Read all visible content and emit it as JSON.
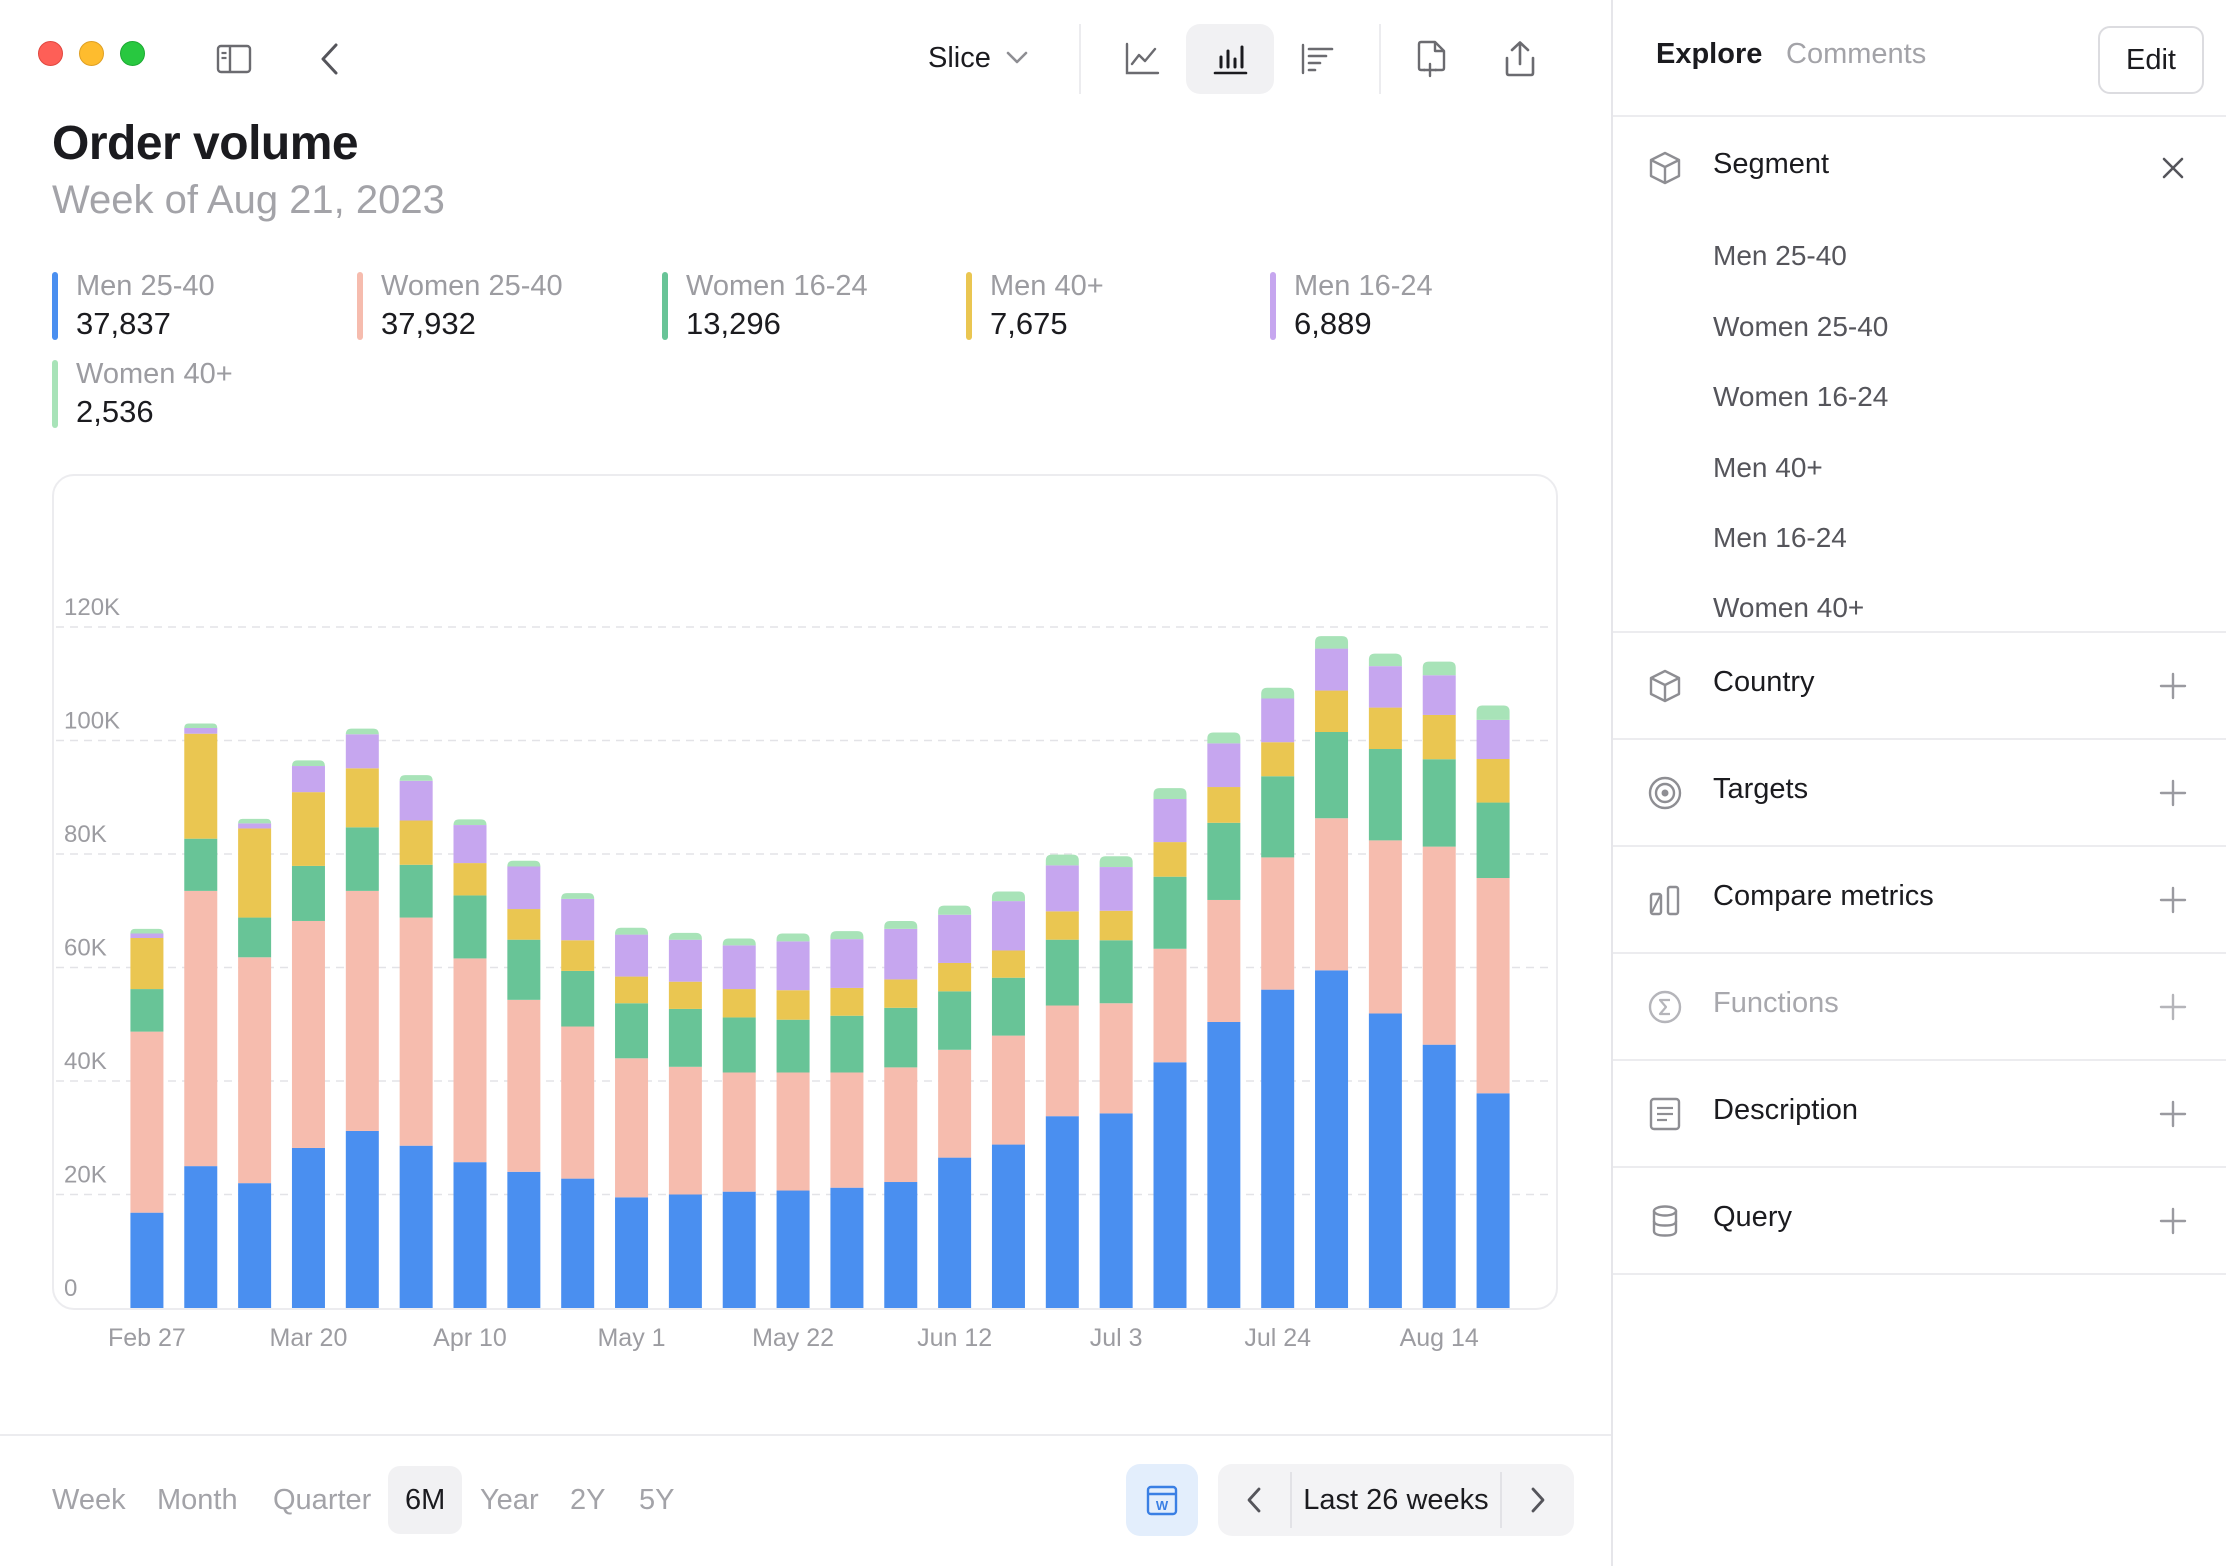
{
  "toolbar": {
    "slice_label": "Slice"
  },
  "header": {
    "title": "Order volume",
    "subtitle": "Week of Aug 21, 2023"
  },
  "legend": [
    {
      "name": "Men 25-40",
      "value": "37,837",
      "color": "#4a8ff0"
    },
    {
      "name": "Women 25-40",
      "value": "37,932",
      "color": "#f6bcae"
    },
    {
      "name": "Women 16-24",
      "value": "13,296",
      "color": "#68c497"
    },
    {
      "name": "Men 40+",
      "value": "7,675",
      "color": "#eac651"
    },
    {
      "name": "Men 16-24",
      "value": "6,889",
      "color": "#c6a6ef"
    },
    {
      "name": "Women 40+",
      "value": "2,536",
      "color": "#a8e3b8"
    }
  ],
  "chart_data": {
    "type": "bar",
    "stacked": true,
    "ylim": [
      0,
      120000
    ],
    "yticks": [
      "0",
      "20K",
      "40K",
      "60K",
      "80K",
      "100K",
      "120K"
    ],
    "xtick_labels": [
      "Feb 27",
      "Mar 20",
      "Apr 10",
      "May 1",
      "May 22",
      "Jun 12",
      "Jul 3",
      "Jul 24",
      "Aug 14"
    ],
    "grid": true,
    "categories": [
      "Feb 27",
      "Mar 6",
      "Mar 13",
      "Mar 20",
      "Mar 27",
      "Apr 3",
      "Apr 10",
      "Apr 17",
      "Apr 24",
      "May 1",
      "May 8",
      "May 15",
      "May 22",
      "May 29",
      "Jun 5",
      "Jun 12",
      "Jun 19",
      "Jun 26",
      "Jul 3",
      "Jul 10",
      "Jul 17",
      "Jul 24",
      "Jul 31",
      "Aug 7",
      "Aug 14",
      "Aug 21"
    ],
    "series": [
      {
        "name": "Men 25-40",
        "color": "#4a8ff0",
        "values": [
          16800,
          25000,
          22000,
          28200,
          31200,
          28600,
          25700,
          24000,
          22800,
          19500,
          20000,
          20500,
          20700,
          21200,
          22200,
          26500,
          28800,
          33800,
          34300,
          43300,
          50400,
          56100,
          59500,
          51900,
          46400,
          37837
        ]
      },
      {
        "name": "Women 25-40",
        "color": "#f6bcae",
        "values": [
          31900,
          48500,
          39800,
          40000,
          42300,
          40200,
          35900,
          30300,
          26800,
          24500,
          22500,
          21000,
          20800,
          20300,
          20200,
          19000,
          19200,
          19500,
          19400,
          20000,
          21500,
          23300,
          26800,
          30500,
          34900,
          37932
        ]
      },
      {
        "name": "Women 16-24",
        "color": "#68c497",
        "values": [
          7500,
          9200,
          7000,
          9700,
          11200,
          9300,
          11100,
          10600,
          9800,
          9700,
          10200,
          9700,
          9300,
          10000,
          10500,
          10300,
          10200,
          11600,
          11100,
          12700,
          13600,
          14300,
          15200,
          16100,
          15400,
          13296
        ]
      },
      {
        "name": "Men 40+",
        "color": "#eac651",
        "values": [
          9000,
          18500,
          15700,
          13000,
          10400,
          7800,
          5700,
          5400,
          5400,
          4700,
          4800,
          5000,
          5200,
          4900,
          5000,
          5000,
          4800,
          5000,
          5200,
          6100,
          6300,
          6000,
          7300,
          7300,
          7800,
          7675
        ]
      },
      {
        "name": "Men 16-24",
        "color": "#c6a6ef",
        "values": [
          800,
          1000,
          900,
          4600,
          6000,
          7000,
          6700,
          7500,
          7300,
          7400,
          7400,
          7700,
          8600,
          8600,
          8900,
          8500,
          8700,
          8100,
          7700,
          7600,
          7700,
          7700,
          7400,
          7300,
          7000,
          6889
        ]
      },
      {
        "name": "Women 40+",
        "color": "#a8e3b8",
        "values": [
          800,
          800,
          800,
          1000,
          1000,
          1000,
          1000,
          1000,
          1000,
          1200,
          1200,
          1200,
          1400,
          1400,
          1400,
          1600,
          1700,
          1900,
          1900,
          1900,
          1900,
          1900,
          2200,
          2200,
          2400,
          2536
        ]
      }
    ]
  },
  "time_ranges": [
    "Week",
    "Month",
    "Quarter",
    "6M",
    "Year",
    "2Y",
    "5Y"
  ],
  "active_range": "6M",
  "period": {
    "label": "Last 26 weeks",
    "calendar_badge": "W"
  },
  "panel": {
    "tabs": [
      "Explore",
      "Comments"
    ],
    "edit_label": "Edit",
    "segment": {
      "label": "Segment",
      "items": [
        "Men 25-40",
        "Women 25-40",
        "Women 16-24",
        "Men 40+",
        "Men 16-24",
        "Women 40+"
      ]
    },
    "sections": [
      {
        "label": "Country",
        "icon": "cube-icon",
        "enabled": true
      },
      {
        "label": "Targets",
        "icon": "target-icon",
        "enabled": true
      },
      {
        "label": "Compare metrics",
        "icon": "compare-icon",
        "enabled": true
      },
      {
        "label": "Functions",
        "icon": "sigma-icon",
        "enabled": false
      },
      {
        "label": "Description",
        "icon": "document-icon",
        "enabled": true
      },
      {
        "label": "Query",
        "icon": "database-icon",
        "enabled": true
      }
    ]
  }
}
